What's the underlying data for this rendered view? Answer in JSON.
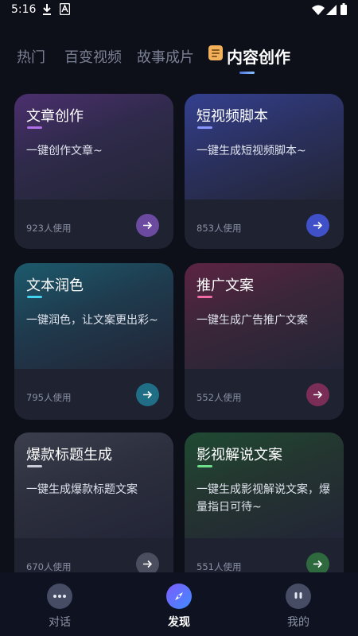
{
  "status_bar": {
    "time": "5:16"
  },
  "tabs": [
    {
      "label": "热门"
    },
    {
      "label": "百变视频"
    },
    {
      "label": "故事成片"
    },
    {
      "label": "内容创作",
      "active": true
    }
  ],
  "cards": [
    {
      "title": "文章创作",
      "description": "一键创作文章~",
      "usage": "923人使用",
      "accent": "#b071e8",
      "button_color": "#6b4aa0"
    },
    {
      "title": "短视频脚本",
      "description": "一键生成短视频脚本~",
      "usage": "853人使用",
      "accent": "#8a96ff",
      "button_color": "#3f50c9"
    },
    {
      "title": "文本润色",
      "description": "一键润色，让文案更出彩~",
      "usage": "795人使用",
      "accent": "#44d3f0",
      "button_color": "#1f6e86"
    },
    {
      "title": "推广文案",
      "description": "一键生成广告推广文案",
      "usage": "552人使用",
      "accent": "#f06aa6",
      "button_color": "#7a2d57"
    },
    {
      "title": "爆款标题生成",
      "description": "一键生成爆款标题文案",
      "usage": "670人使用",
      "accent": "#c9ccd6",
      "button_color": "#4a4e5e"
    },
    {
      "title": "影视解说文案",
      "description": "一键生成影视解说文案，爆量指日可待~",
      "usage": "551人使用",
      "accent": "#6ee08c",
      "button_color": "#2f6a3e"
    }
  ],
  "bottom_nav": [
    {
      "label": "对话",
      "icon": "chat-bubble-icon"
    },
    {
      "label": "发现",
      "icon": "compass-icon",
      "active": true
    },
    {
      "label": "我的",
      "icon": "profile-face-icon"
    }
  ]
}
